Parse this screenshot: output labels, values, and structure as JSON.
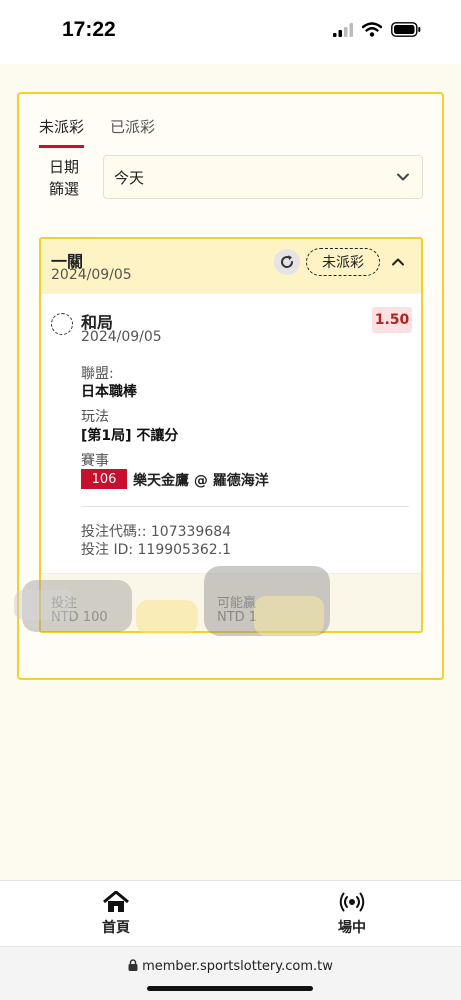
{
  "status_bar": {
    "time": "17:22"
  },
  "tabs": [
    {
      "label": "未派彩",
      "active": true
    },
    {
      "label": "已派彩",
      "active": false
    }
  ],
  "filter": {
    "label": "日期篩選",
    "value": "今天"
  },
  "bet": {
    "type": "一關",
    "date": "2024/09/05",
    "status": "未派彩",
    "selection": "和局",
    "selection_date": "2024/09/05",
    "odds": "1.50",
    "league_label": "聯盟:",
    "league": "日本職棒",
    "play_label": "玩法",
    "play": "[第1局] 不讓分",
    "match_label": "賽事",
    "match_no": "106",
    "match": "樂天金鷹 @ 羅德海洋",
    "code_line": "投注代碼:: 107339684",
    "id_line": "投注 ID: 119905362.1",
    "footer": {
      "stake_label": "投注",
      "stake_value": "NTD 100",
      "payout_label": "可能贏",
      "payout_value": "NTD 1"
    }
  },
  "nav": [
    {
      "label": "首頁",
      "icon": "home-icon"
    },
    {
      "label": "場中",
      "icon": "live-icon"
    }
  ],
  "url": "member.sportslottery.com.tw",
  "colors": {
    "accent": "#c8102e",
    "border": "#f2d12a",
    "header": "#fdf3c4"
  }
}
